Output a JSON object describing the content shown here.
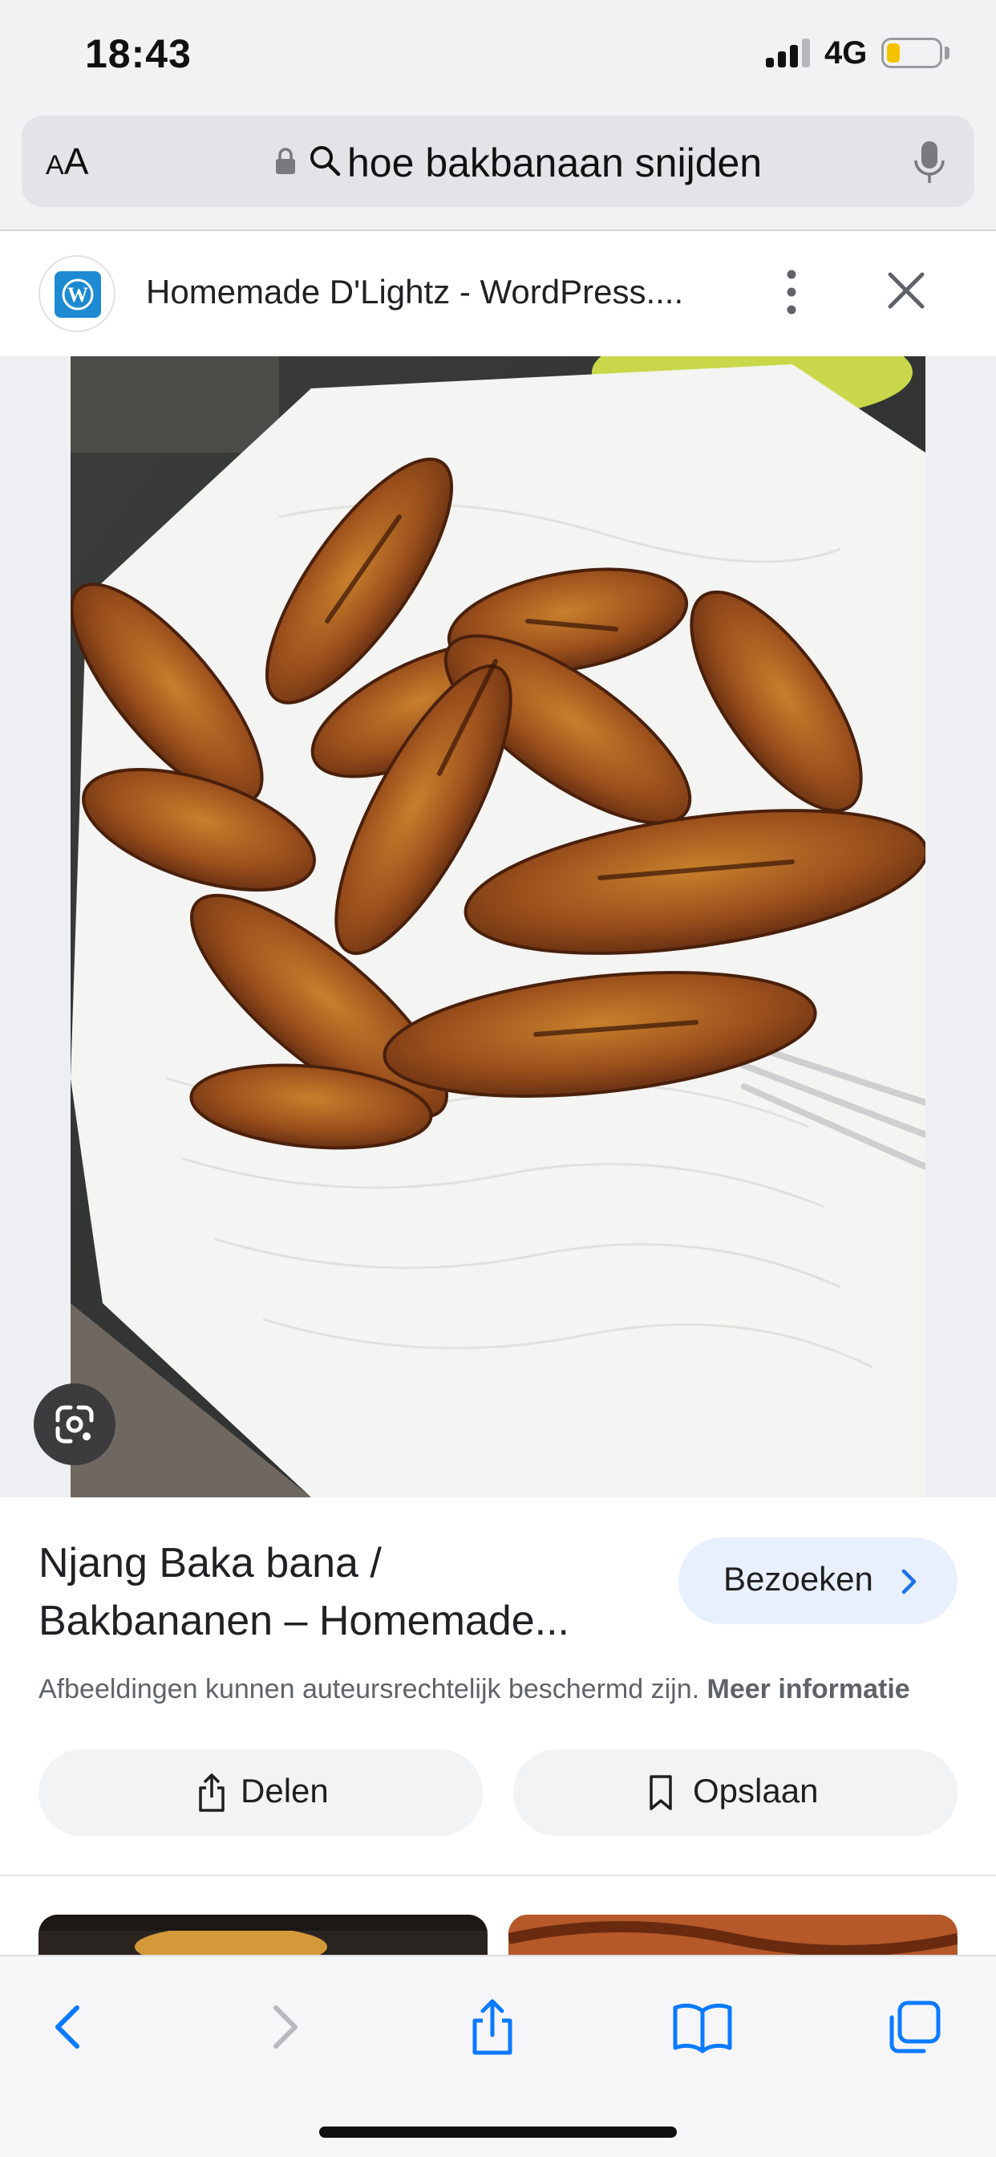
{
  "status_bar": {
    "time": "18:43",
    "network": "4G",
    "battery_color": "#f5c400"
  },
  "address_bar": {
    "aa_small": "A",
    "aa_large": "A",
    "query": "hoe bakbanaan snijden"
  },
  "source": {
    "title": "Homemade D'Lightz - WordPress....",
    "favicon_color": "#1d8ad1"
  },
  "result": {
    "title_line1": "Njang Baka bana /",
    "title_line2": "Bakbananen – Homemade...",
    "visit_label": "Bezoeken",
    "copyright_text": "Afbeeldingen kunnen auteursrechtelijk beschermd zijn.",
    "copyright_link": "Meer informatie",
    "share_label": "Delen",
    "save_label": "Opslaan"
  },
  "icons": {
    "lock": "lock-icon",
    "search": "search-icon",
    "mic": "microphone-icon",
    "more": "more-vertical-icon",
    "close": "close-icon",
    "lens": "google-lens-icon",
    "share": "share-icon",
    "bookmark": "bookmark-icon",
    "back": "chevron-left-icon",
    "forward": "chevron-right-icon",
    "book": "book-icon",
    "tabs": "tabs-icon"
  },
  "colors": {
    "accent_blue": "#1a73e8",
    "ios_blue": "#0a7aff",
    "visit_bg": "#e8effd"
  }
}
